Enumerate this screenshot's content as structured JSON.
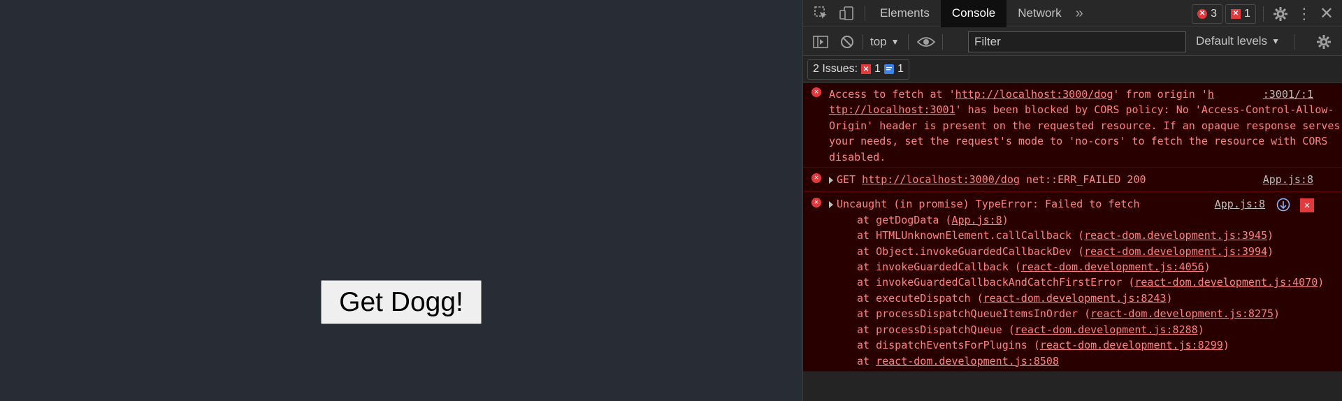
{
  "page": {
    "button_label": "Get Dogg!"
  },
  "devtools": {
    "tabs": [
      "Elements",
      "Console",
      "Network"
    ],
    "active_tab": "Console",
    "error_count": "3",
    "issue_count_badge": "1",
    "context_label": "top",
    "filter_placeholder": "Filter",
    "levels_label": "Default levels",
    "issues": {
      "label": "2 Issues:",
      "error_count": "1",
      "info_count": "1"
    }
  },
  "console": {
    "cors_error": {
      "prefix": "Access to fetch at '",
      "url": "http://localhost:3000/dog",
      "mid": "' from origin '",
      "origin_frag": "h",
      "origin_src": ":3001/:1",
      "origin_url": "ttp://localhost:3001",
      "rest": "' has been blocked by CORS policy: No 'Access-Control-Allow-Origin' header is present on the requested resource. If an opaque response serves your needs, set the request's mode to 'no-cors' to fetch the resource with CORS disabled."
    },
    "get_error": {
      "method": "GET",
      "url": "http://localhost:3000/dog",
      "status": "net::ERR_FAILED 200",
      "source": "App.js:8"
    },
    "type_error": {
      "text": "Uncaught (in promise) TypeError: Failed to fetch",
      "source": "App.js:8",
      "stack": [
        {
          "fn": "at getDogData (",
          "link": "App.js:8",
          "end": ")"
        },
        {
          "fn": "at HTMLUnknownElement.callCallback (",
          "link": "react-dom.development.js:3945",
          "end": ")"
        },
        {
          "fn": "at Object.invokeGuardedCallbackDev (",
          "link": "react-dom.development.js:3994",
          "end": ")"
        },
        {
          "fn": "at invokeGuardedCallback (",
          "link": "react-dom.development.js:4056",
          "end": ")"
        },
        {
          "fn": "at invokeGuardedCallbackAndCatchFirstError (",
          "link": "react-dom.development.js:4070",
          "end": ")"
        },
        {
          "fn": "at executeDispatch (",
          "link": "react-dom.development.js:8243",
          "end": ")"
        },
        {
          "fn": "at processDispatchQueueItemsInOrder (",
          "link": "react-dom.development.js:8275",
          "end": ")"
        },
        {
          "fn": "at processDispatchQueue (",
          "link": "react-dom.development.js:8288",
          "end": ")"
        },
        {
          "fn": "at dispatchEventsForPlugins (",
          "link": "react-dom.development.js:8299",
          "end": ")"
        },
        {
          "fn": "at ",
          "link": "react-dom.development.js:8508",
          "end": ""
        }
      ]
    }
  },
  "icons": {
    "inspect": "inspect-element-icon",
    "device": "device-toolbar-icon",
    "more_tabs": "more-tabs-icon",
    "settings": "gear-icon",
    "menu": "kebab-menu-icon",
    "close": "close-icon",
    "sidebar": "sidebar-toggle-icon",
    "clear": "clear-console-icon",
    "eye": "live-expression-icon",
    "colors": {
      "error": "#e4393c",
      "info": "#3b82e6",
      "error_text": "#ff8080"
    }
  }
}
